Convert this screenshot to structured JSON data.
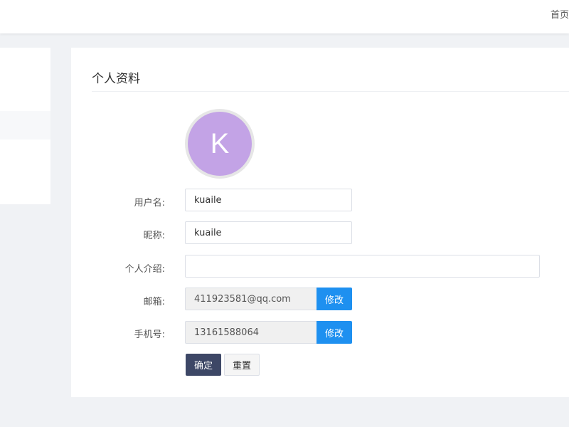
{
  "topbar": {
    "home_label": "首页"
  },
  "card": {
    "title": "个人资料"
  },
  "avatar": {
    "letter": "K",
    "color": "#c3a3e6"
  },
  "form": {
    "username": {
      "label": "用户名:",
      "value": "kuaile"
    },
    "nickname": {
      "label": "昵称:",
      "value": "kuaile"
    },
    "bio": {
      "label": "个人介绍:",
      "value": ""
    },
    "email": {
      "label": "邮箱:",
      "value": "411923581@qq.com",
      "edit_label": "修改"
    },
    "phone": {
      "label": "手机号:",
      "value": "13161588064",
      "edit_label": "修改"
    }
  },
  "actions": {
    "confirm_label": "确定",
    "reset_label": "重置"
  },
  "colors": {
    "accent": "#1e90f0",
    "primary_button": "#3d4766",
    "page_background": "#f0f2f5"
  }
}
